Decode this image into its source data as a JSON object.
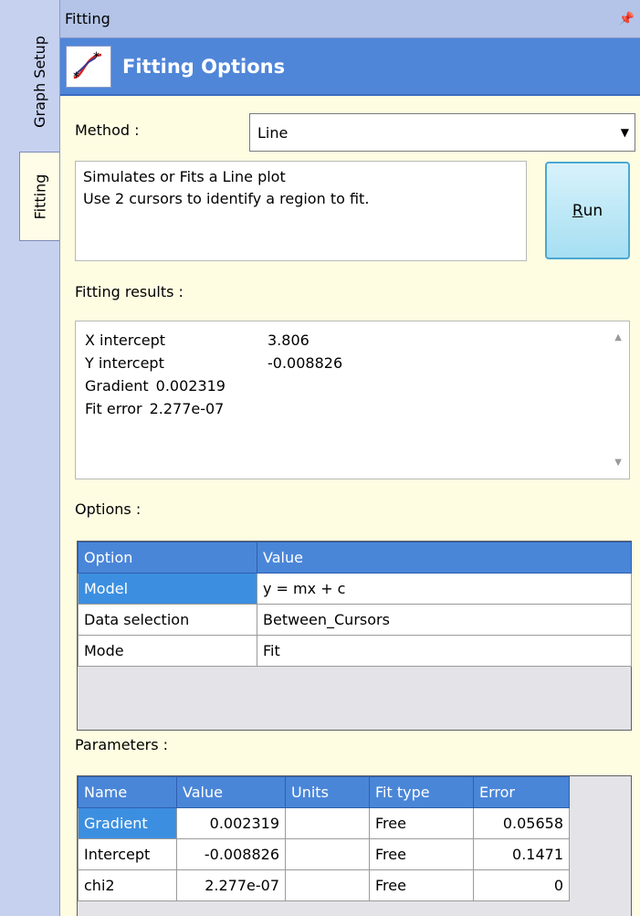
{
  "tabs": {
    "graph_setup": "Graph Setup",
    "fitting": "Fitting"
  },
  "panel": {
    "title": "Fitting",
    "header_title": "Fitting Options"
  },
  "method": {
    "label": "Method :",
    "selected": "Line"
  },
  "description": {
    "line1": "Simulates or Fits a Line plot",
    "line2": "Use 2 cursors to identify a region to fit."
  },
  "run_button": {
    "accel": "R",
    "rest": "un"
  },
  "fitting_results": {
    "label": "Fitting results :",
    "rows": [
      {
        "key": "X intercept",
        "value": "3.806"
      },
      {
        "key": "Y intercept",
        "value": "-0.008826"
      },
      {
        "key": "Gradient",
        "value": "0.002319"
      },
      {
        "key": "Fit error",
        "value": "2.277e-07"
      }
    ]
  },
  "options": {
    "label": "Options :",
    "headers": [
      "Option",
      "Value"
    ],
    "rows": [
      [
        "Model",
        "y = mx + c"
      ],
      [
        "Data selection",
        "Between_Cursors"
      ],
      [
        "Mode",
        "Fit"
      ]
    ]
  },
  "parameters": {
    "label": "Parameters :",
    "headers": [
      "Name",
      "Value",
      "Units",
      "Fit type",
      "Error"
    ],
    "rows": [
      [
        "Gradient",
        "0.002319",
        "",
        "Free",
        "0.05658"
      ],
      [
        "Intercept",
        "-0.008826",
        "",
        "Free",
        "0.1471"
      ],
      [
        "chi2",
        "2.277e-07",
        "",
        "Free",
        "0"
      ]
    ]
  },
  "colors": {
    "header_blue": "#4f86d8",
    "panel_bg": "#fefde2",
    "selection": "#3c8fe0"
  }
}
